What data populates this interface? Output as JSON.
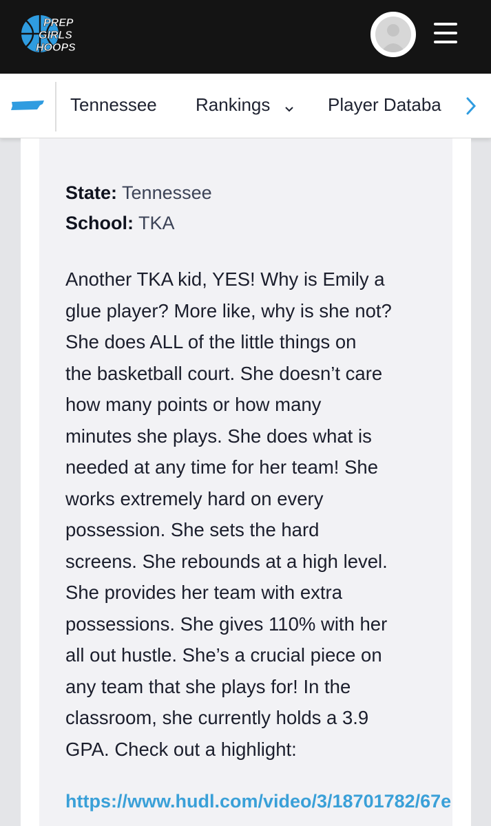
{
  "header": {
    "logo_lines": [
      "PREP",
      "GIRLS",
      "HOOPS"
    ],
    "colors": {
      "background": "#141414",
      "brand_blue": "#2f9ce0"
    }
  },
  "nav": {
    "state_icon": "tennessee-map-icon",
    "items": [
      {
        "label": "Tennessee"
      },
      {
        "label": "Rankings"
      },
      {
        "label": "Player Databa"
      }
    ]
  },
  "profile": {
    "state_label": "State:",
    "state_value": "Tennessee",
    "school_label": "School:",
    "school_value": "TKA"
  },
  "article": {
    "lines": [
      "Another TKA kid, YES! Why is Emily a",
      "glue player? More like, why is she not?",
      "She does ALL of the little things on",
      "the basketball court. She doesn’t care",
      "how many points or how many",
      "minutes she plays. She does what is",
      "needed at any time for her team! She",
      "works extremely hard on every",
      "possession. She sets the hard",
      "screens. She rebounds at a high level.",
      "She provides her team with extra",
      "possessions. She gives 110% with her",
      "all out hustle. She’s a crucial piece on",
      "any team that she plays for! In the",
      "classroom, she currently holds a 3.9",
      "GPA. Check out a highlight:"
    ],
    "link_text": "https://www.hudl.com/video/3/18701782/67e"
  }
}
